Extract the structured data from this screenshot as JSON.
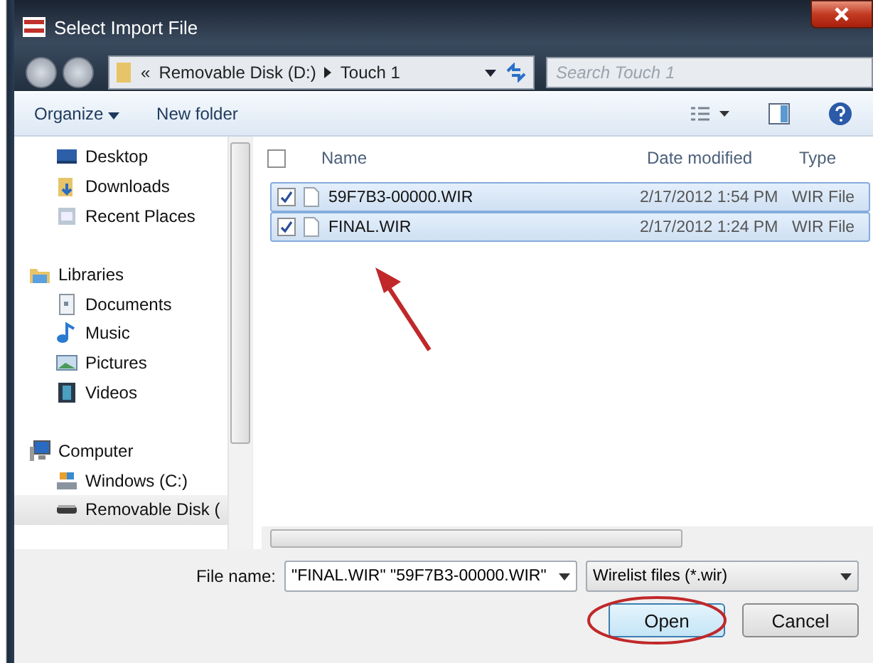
{
  "window": {
    "title": "Select Import File"
  },
  "address": {
    "overflow": "«",
    "path": [
      "Removable Disk (D:)",
      "Touch 1"
    ]
  },
  "search": {
    "placeholder": "Search Touch 1"
  },
  "toolbar": {
    "buttons": [
      "Organize",
      "New folder"
    ]
  },
  "nav_tree": [
    {
      "children": [
        {
          "label": "Desktop",
          "kind": "desktop",
          "selected": false
        },
        {
          "label": "Downloads",
          "kind": "downloads",
          "selected": false
        },
        {
          "label": "Recent Places",
          "kind": "recent",
          "selected": false
        }
      ]
    },
    {
      "label": "Libraries",
      "kind": "libraries",
      "selected": false,
      "children": [
        {
          "label": "Documents",
          "kind": "documents",
          "selected": false
        },
        {
          "label": "Music",
          "kind": "music",
          "selected": false
        },
        {
          "label": "Pictures",
          "kind": "pictures",
          "selected": false
        },
        {
          "label": "Videos",
          "kind": "videos",
          "selected": false
        }
      ]
    },
    {
      "label": "Computer",
      "kind": "computer",
      "selected": false,
      "children": [
        {
          "label": "Windows (C:)",
          "kind": "drive",
          "selected": false
        },
        {
          "label": "Removable Disk (",
          "kind": "removable",
          "selected": true
        }
      ]
    }
  ],
  "table": {
    "columns": [
      "Name",
      "Date modified",
      "Type"
    ],
    "select_all_checked": false,
    "rows": [
      {
        "name": "59F7B3-00000.WIR",
        "date": "2/17/2012 1:54 PM",
        "type": "WIR File",
        "checked": true,
        "selected": true
      },
      {
        "name": "FINAL.WIR",
        "date": "2/17/2012 1:24 PM",
        "type": "WIR File",
        "checked": true,
        "selected": true
      }
    ]
  },
  "file_name": {
    "label": "File name:",
    "value": "\"FINAL.WIR\" \"59F7B3-00000.WIR\""
  },
  "filter": {
    "value": "Wirelist files (*.wir)"
  },
  "buttons": [
    {
      "label": "Open",
      "kind": "primary",
      "highlighted": true
    },
    {
      "label": "Cancel",
      "kind": "secondary",
      "highlighted": false
    }
  ]
}
